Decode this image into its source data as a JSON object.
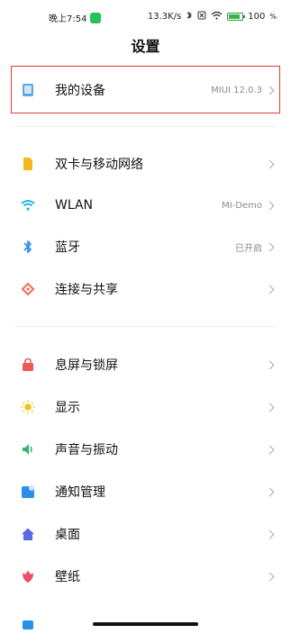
{
  "status_bar": {
    "time": "晚上7:54",
    "network_speed": "13.3K/s",
    "battery": "100"
  },
  "page": {
    "title": "设置"
  },
  "items": [
    {
      "label": "我的设备",
      "value": "MIUI 12.0.3",
      "icon": "device-icon",
      "color": "#5aa7e8"
    },
    {
      "label": "双卡与移动网络",
      "value": "",
      "icon": "sim-card-icon",
      "color": "#f6b71d"
    },
    {
      "label": "WLAN",
      "value": "MI-Demo",
      "icon": "wifi-icon",
      "color": "#1fb2e6"
    },
    {
      "label": "蓝牙",
      "value": "已开启",
      "icon": "bluetooth-icon",
      "color": "#2a92e9"
    },
    {
      "label": "连接与共享",
      "value": "",
      "icon": "share-icon",
      "color": "#f06e4f"
    },
    {
      "label": "息屏与锁屏",
      "value": "",
      "icon": "lock-icon",
      "color": "#ec5a5a"
    },
    {
      "label": "显示",
      "value": "",
      "icon": "sun-icon",
      "color": "#f6c21a"
    },
    {
      "label": "声音与振动",
      "value": "",
      "icon": "speaker-icon",
      "color": "#27b86b"
    },
    {
      "label": "通知管理",
      "value": "",
      "icon": "notification-icon",
      "color": "#2a8fe8"
    },
    {
      "label": "桌面",
      "value": "",
      "icon": "home-icon",
      "color": "#5a69e7"
    },
    {
      "label": "壁纸",
      "value": "",
      "icon": "wallpaper-icon",
      "color": "#ea4f6a"
    }
  ]
}
